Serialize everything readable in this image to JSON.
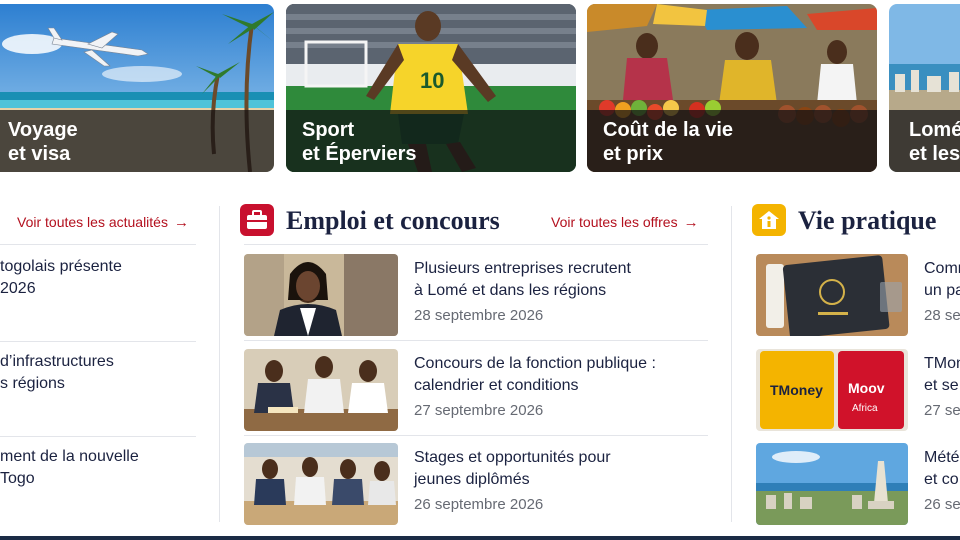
{
  "cards": [
    {
      "line1": "Voyage",
      "line2": "et visa"
    },
    {
      "line1": "Sport",
      "line2": "et Éperviers"
    },
    {
      "line1": "Coût de la vie",
      "line2": "et prix"
    },
    {
      "line1": "Lomé",
      "line2": "et les"
    }
  ],
  "left_column": {
    "see_all": "Voir toutes les actualités",
    "items": [
      {
        "line1": "togolais présente",
        "line2": "2026"
      },
      {
        "line1": "d’infrastructures",
        "line2": "s régions"
      },
      {
        "line1": "ment de la nouvelle",
        "line2": "Togo"
      }
    ]
  },
  "jobs": {
    "title": "Emploi et concours",
    "see_all": "Voir toutes les offres",
    "items": [
      {
        "title_l1": "Plusieurs entreprises recrutent",
        "title_l2": "à Lomé et dans les régions",
        "date": "28 septembre 2026"
      },
      {
        "title_l1": "Concours de la fonction publique :",
        "title_l2": "calendrier et conditions",
        "date": "27 septembre 2026"
      },
      {
        "title_l1": "Stages et opportunités pour",
        "title_l2": "jeunes diplômés",
        "date": "26 septembre 2026"
      }
    ]
  },
  "practical": {
    "title": "Vie pratique",
    "items": [
      {
        "line1": "Comm",
        "line2": "un pa",
        "date": "28 se"
      },
      {
        "line1": "TMon",
        "line2": "et se",
        "date": "27 se"
      },
      {
        "line1": "Météo",
        "line2": "et co",
        "date": "26 se"
      }
    ],
    "tmoney_label": "TMoney",
    "flooz_label": "Moov",
    "flooz_sub": "Africa"
  },
  "colors": {
    "accent_red": "#b3101e",
    "navy": "#1b2240",
    "icon_yellow": "#f4b400",
    "icon_red": "#c8102e"
  },
  "icons": {
    "see_all_arrow": "arrow-right-icon",
    "jobs_icon": "briefcase-icon",
    "practical_icon": "info-house-icon"
  }
}
